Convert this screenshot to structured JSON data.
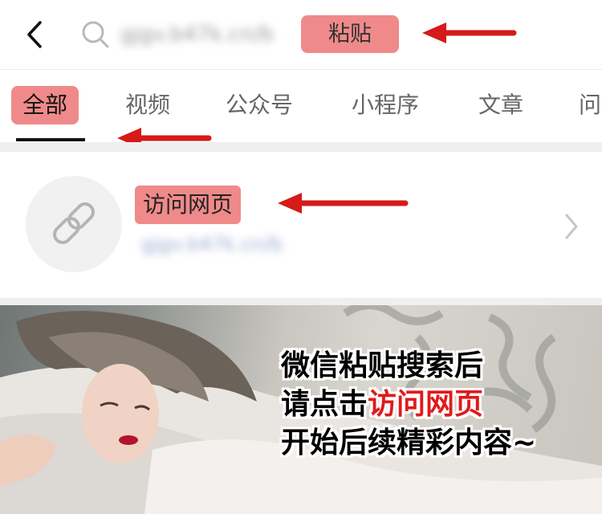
{
  "header": {
    "query_text": "gjgv.b47k.cn/b",
    "paste_label": "粘贴"
  },
  "tabs": [
    {
      "label": "全部",
      "active": true
    },
    {
      "label": "视频"
    },
    {
      "label": "公众号"
    },
    {
      "label": "小程序"
    },
    {
      "label": "文章"
    },
    {
      "label": "问"
    }
  ],
  "result": {
    "title": "访问网页",
    "url": "gjgv.b47k.cn/b"
  },
  "banner": {
    "line1": "微信粘贴搜索后",
    "line2_prefix": "请点击",
    "line2_highlight": "访问网页",
    "line3": "开始后续精彩内容~"
  },
  "colors": {
    "highlight": "#f08a8a",
    "arrow": "#d61a1a",
    "banner_emphasis": "#e01a1a"
  },
  "icons": [
    "back-icon",
    "search-icon",
    "link-icon",
    "chevron-right-icon"
  ]
}
